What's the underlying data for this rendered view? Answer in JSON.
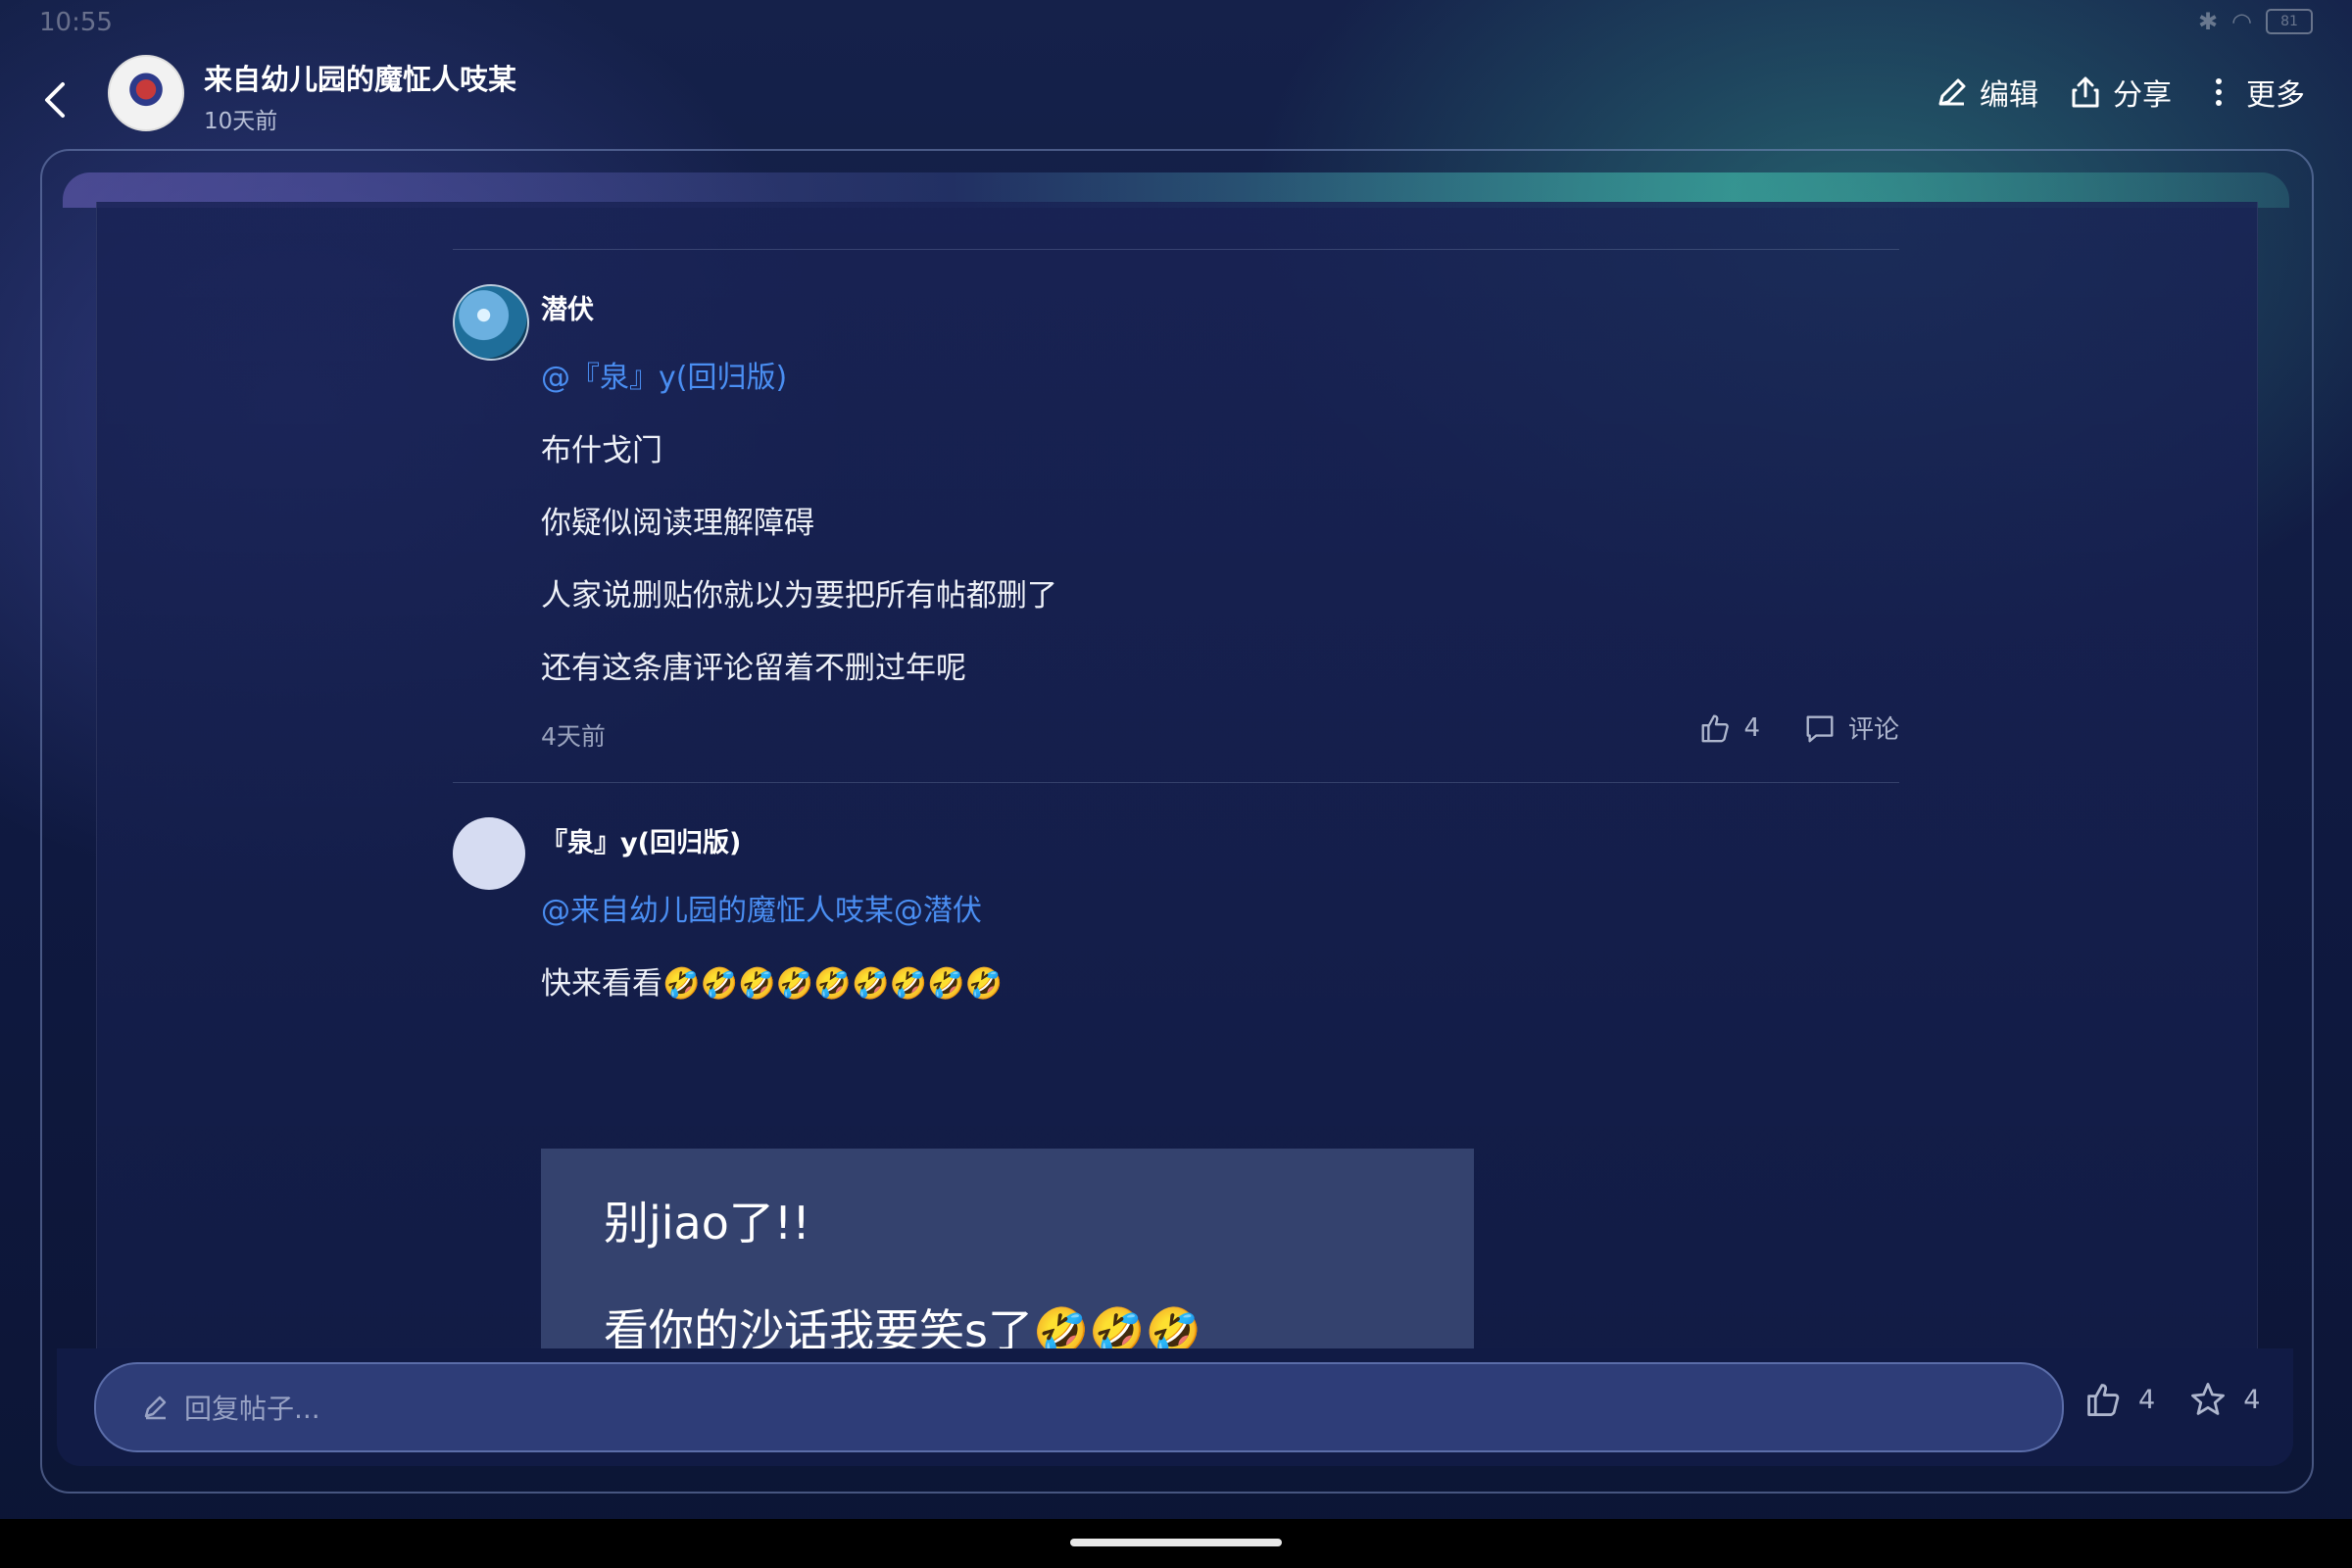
{
  "status_bar": {
    "time": "10:55",
    "battery": "81"
  },
  "header": {
    "author": "来自幼儿园的魔怔人吱某",
    "time": "10天前",
    "actions": {
      "edit": "编辑",
      "share": "分享",
      "more": "更多"
    }
  },
  "comments": [
    {
      "name": "潜伏",
      "mention": "@『泉』y(回归版)",
      "lines": [
        "布什戈门",
        "你疑似阅读理解障碍",
        "人家说删贴你就以为要把所有帖都删了",
        "还有这条唐评论留着不删过年呢"
      ],
      "time": "4天前",
      "likes": "4",
      "comment_label": "评论"
    },
    {
      "name": "『泉』y(回归版)",
      "mention": "@来自幼儿园的魔怔人吱某@潜伏",
      "text": "快来看看🤣🤣🤣🤣🤣🤣🤣🤣🤣",
      "image_text": {
        "line1": "别jiao了!!",
        "line2": "看你的沙话我要笑s了🤣🤣🤣"
      }
    }
  ],
  "reply_bar": {
    "placeholder": "回复帖子...",
    "likes": "4",
    "stars": "4"
  }
}
